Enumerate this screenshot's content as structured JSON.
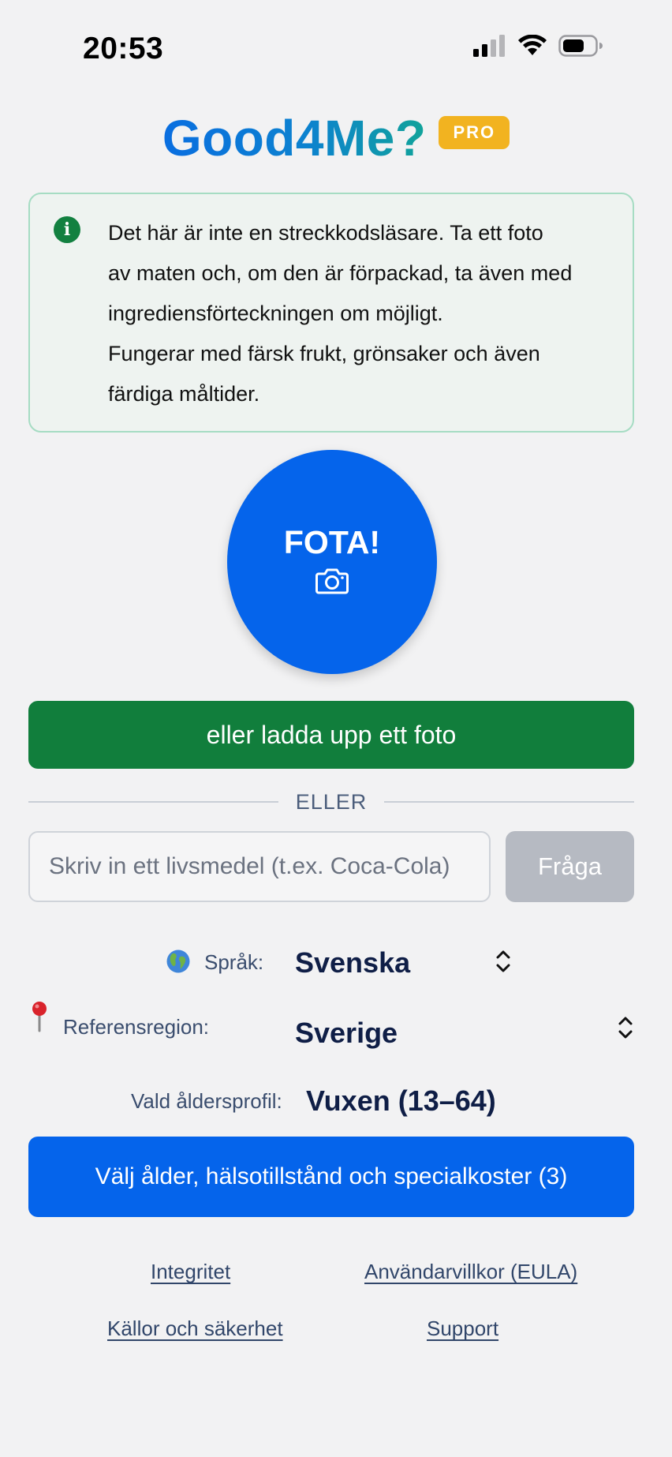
{
  "status_bar": {
    "time": "20:53"
  },
  "header": {
    "title": "Good4Me?",
    "badge": "PRO"
  },
  "info": {
    "lines": [
      "Det här är inte en streckkodsläsare. Ta ett foto",
      "av maten och, om den är förpackad, ta även med",
      "ingrediensförteckningen om möjligt.",
      "Fungerar med färsk frukt, grönsaker och även",
      "färdiga måltider."
    ],
    "icon": "info-icon"
  },
  "photo_button": {
    "label": "FOTA!",
    "icon": "camera-icon"
  },
  "upload_button": {
    "label": "eller ladda upp ett foto"
  },
  "divider": {
    "label": "ELLER"
  },
  "search": {
    "placeholder": "Skriv in ett livsmedel (t.ex. Coca-Cola)",
    "value": "",
    "button_label": "Fråga"
  },
  "settings": {
    "language": {
      "label": "Språk:",
      "value": "Svenska",
      "icon": "globe-icon"
    },
    "region": {
      "label": "Referensregion:",
      "value": "Sverige",
      "icon": "pin-icon"
    },
    "age": {
      "label": "Vald åldersprofil:",
      "value": "Vuxen (13–64)"
    }
  },
  "choose_button": {
    "label": "Välj ålder, hälsotillstånd och specialkoster (3)"
  },
  "footer": {
    "privacy": "Integritet",
    "terms": "Användarvillkor (EULA)",
    "sources": "Källor och säkerhet",
    "support": "Support"
  },
  "colors": {
    "primary": "#0564eb",
    "green": "#117e3c",
    "badge": "#f2b320"
  }
}
